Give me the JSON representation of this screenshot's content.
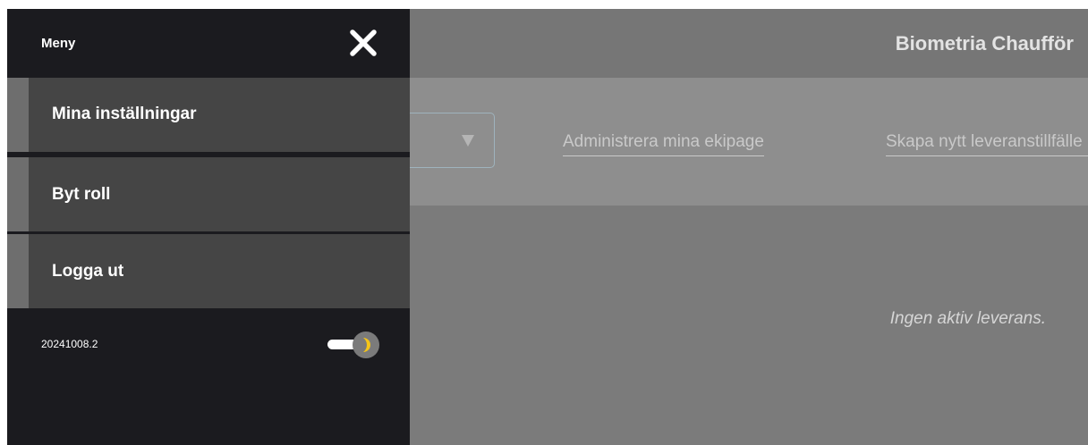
{
  "app": {
    "title": "Biometria Chaufför"
  },
  "toolbar": {
    "link_manage_crews": "Administrera mina ekipage",
    "link_create_delivery": "Skapa nytt leveranstillfälle"
  },
  "main": {
    "empty_message": "Ingen aktiv leverans."
  },
  "menu": {
    "title": "Meny",
    "items": [
      {
        "label": "Mina inställningar"
      },
      {
        "label": "Byt roll"
      },
      {
        "label": "Logga ut"
      }
    ],
    "version": "20241008.2",
    "theme_toggle": {
      "mode": "dark",
      "icon": "moon-icon"
    }
  },
  "colors": {
    "drawer_bg": "#1b1b1f",
    "menu_item_bg": "#454545",
    "moon": "#f5c518"
  }
}
